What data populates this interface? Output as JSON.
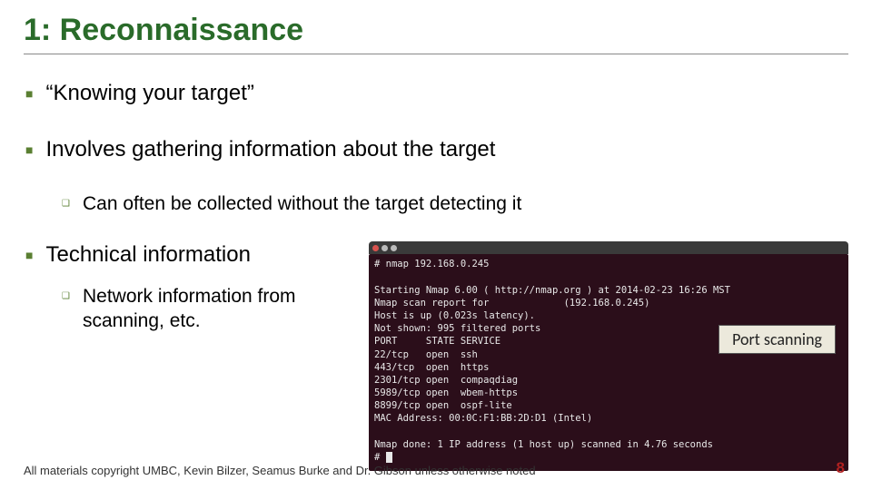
{
  "title": "1: Reconnaissance",
  "bullets": {
    "b1": "“Knowing your target”",
    "b2": "Involves gathering information about the target",
    "b2a": "Can often be collected without the target detecting it",
    "b3": "Technical information",
    "b3a": "Network information from scanning, etc."
  },
  "terminal": {
    "dots": [
      "#d9534f",
      "#ccc",
      "#ccc"
    ],
    "lines": "# nmap 192.168.0.245\n\nStarting Nmap 6.00 ( http://nmap.org ) at 2014-02-23 16:26 MST\nNmap scan report for             (192.168.0.245)\nHost is up (0.023s latency).\nNot shown: 995 filtered ports\nPORT     STATE SERVICE\n22/tcp   open  ssh\n443/tcp  open  https\n2301/tcp open  compaqdiag\n5989/tcp open  wbem-https\n8899/tcp open  ospf-lite\nMAC Address: 00:0C:F1:BB:2D:D1 (Intel)\n\nNmap done: 1 IP address (1 host up) scanned in 4.76 seconds\n# "
  },
  "port_label": "Port scanning",
  "footer": "All materials copyright UMBC, Kevin Bilzer, Seamus Burke and Dr. Gibson unless otherwise noted",
  "page": "8"
}
